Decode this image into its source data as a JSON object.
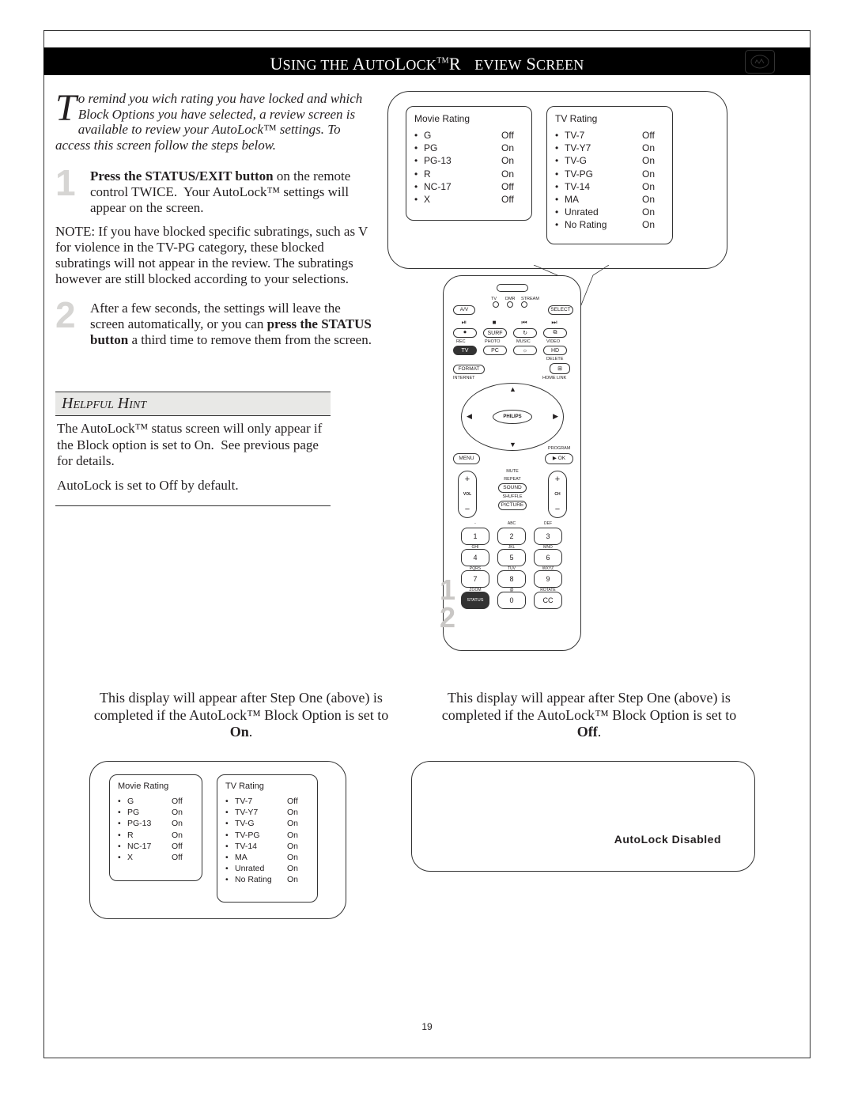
{
  "title_html": "U<span style='font-size:18px'>SING THE</span> A<span style='font-size:18px'>UTO</span>L<span style='font-size:18px'>OCK</span><sup style='font-size:10px'>TM</sup>R&nbsp;&nbsp;&nbsp;<span style='font-size:18px'>EVIEW</span> S<span style='font-size:18px'>CREEN</span>",
  "intro_html": "<span class='dropcap'>T</span>o remind you wich rating you have locked and which Block Options you have selected, a review screen is available to review your AutoLock&trade; settings. To access this screen follow the steps below.",
  "steps": [
    {
      "num": "1",
      "body_html": "<b>Press the STATUS/EXIT button</b> on the remote control TWICE.&nbsp; Your AutoLock&trade; settings will appear on the screen."
    },
    {
      "num": "2",
      "body_html": "After a few seconds, the settings will leave the screen automatically, or you can <b>press the STATUS button</b> a third time to remove them from the screen."
    }
  ],
  "note": "NOTE: If you have blocked specific subratings, such as V for violence in the TV-PG category, these blocked subratings will not appear in the review. The subratings however are still blocked according to your selections.",
  "hint_title": "Helpful Hint",
  "hint_p1": "The AutoLock™ status screen will only appear if the Block option is set to On.  See previous page for details.",
  "hint_p2": "AutoLock is set to Off by default.",
  "ratings": {
    "movie_header": "Movie Rating",
    "tv_header": "TV Rating",
    "movie": [
      {
        "label": "G",
        "value": "Off"
      },
      {
        "label": "PG",
        "value": "On"
      },
      {
        "label": "PG-13",
        "value": "On"
      },
      {
        "label": "R",
        "value": "On"
      },
      {
        "label": "NC-17",
        "value": "Off"
      },
      {
        "label": "X",
        "value": "Off"
      }
    ],
    "tv": [
      {
        "label": "TV-7",
        "value": "Off"
      },
      {
        "label": "TV-Y7",
        "value": "On"
      },
      {
        "label": "TV-G",
        "value": "On"
      },
      {
        "label": "TV-PG",
        "value": "On"
      },
      {
        "label": "TV-14",
        "value": "On"
      },
      {
        "label": "MA",
        "value": "On"
      },
      {
        "label": "Unrated",
        "value": "On"
      },
      {
        "label": "No Rating",
        "value": "On"
      }
    ]
  },
  "remote": {
    "brand": "PHILIPS",
    "top_tiny": [
      "TV",
      "DMR",
      "STREAM"
    ],
    "row1": {
      "left": "A/V",
      "right": "SELECT"
    },
    "row2_icons": [
      "⏯",
      "■",
      "⏮",
      "⏭"
    ],
    "row3": [
      "⏺",
      "SURF",
      "↻",
      "⧉"
    ],
    "row3_labels": [
      "REC",
      "PHOTO",
      "MUSIC",
      "VIDEO"
    ],
    "row4": [
      "TV",
      "PC",
      "☼",
      "HD"
    ],
    "row4_right_label": "DELETE",
    "row5_left": "FORMAT",
    "row5_right_icon": "⊞",
    "row5_labels": [
      "INTERNET",
      "HOME LINK"
    ],
    "menu": "MENU",
    "ok": "▶ OK",
    "program": "PROGRAM",
    "mid_labels": [
      "MUTE",
      "REPEAT",
      "SOUND",
      "SHUFFLE",
      "PICTURE"
    ],
    "vol": "VOL",
    "ch": "CH",
    "num_labels_row": [
      "-",
      "ABC",
      "DEF",
      "GHI",
      "JKL",
      "MNO",
      "PQRS",
      "TUV",
      "WXYZ",
      "ZOOM",
      "@",
      "ROTATE"
    ],
    "numbers": [
      "1",
      "2",
      "3",
      "4",
      "5",
      "6",
      "7",
      "8",
      "9"
    ],
    "bottom": [
      "STATUS",
      "0",
      "CC"
    ]
  },
  "callouts": {
    "c1": "1",
    "c2": "2"
  },
  "caption_on_html": "This display will appear after Step One (above) is completed if the AutoLock&trade; Block Option is set to <b>On</b>.",
  "caption_off_html": "This display will appear after Step One (above) is completed if the AutoLock&trade; Block Option is set to <b>Off</b>.",
  "disabled_msg": "AutoLock  Disabled",
  "page_number": "19"
}
